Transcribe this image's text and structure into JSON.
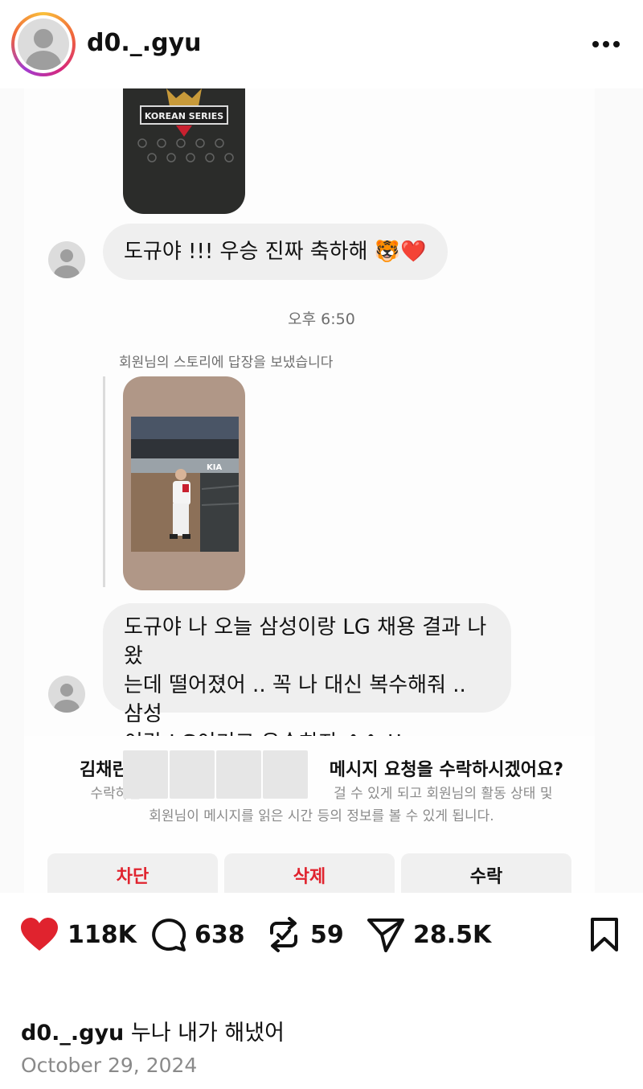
{
  "header": {
    "username": "d0._.gyu",
    "more_icon": "ellipsis-horizontal-icon"
  },
  "dm": {
    "story_top_caption": "Korean Series",
    "message1": "도규야 !!! 우승 진짜 축하해 🐯❤️",
    "time": "오후 6:50",
    "reply_label": "회원님의 스토리에 답장을 보냈습니다",
    "message2_lines": [
      "도규야 나 오늘 삼성이랑 LG 채용 결과 나왔",
      "는데 떨어졌어 .. 꼭 나 대신 복수해줘 .. 삼성",
      "이랑 LG이기고 우승하자 ^^ !!"
    ]
  },
  "request": {
    "title_name": "김채린",
    "title_rest": "메시지 요청을 수락하시겠어요?",
    "body_line1_start": "수락하면",
    "body_line1_end": "걸 수 있게 되고 회원님의 활동 상태 및",
    "body_line2": "회원님이 메시지를 읽은 시간 등의 정보를 볼 수 있게 됩니다.",
    "buttons": {
      "block": "차단",
      "delete": "삭제",
      "accept": "수락"
    }
  },
  "actions": {
    "likes": "118K",
    "comments": "638",
    "reposts": "59",
    "shares": "28.5K",
    "icons": [
      "heart-icon",
      "comment-icon",
      "repost-icon",
      "send-icon",
      "bookmark-icon"
    ],
    "like_color": "#e0232e"
  },
  "post": {
    "caption_user": "d0._.gyu",
    "caption_text": "누나 내가 해냈어",
    "date": "October 29, 2024"
  }
}
